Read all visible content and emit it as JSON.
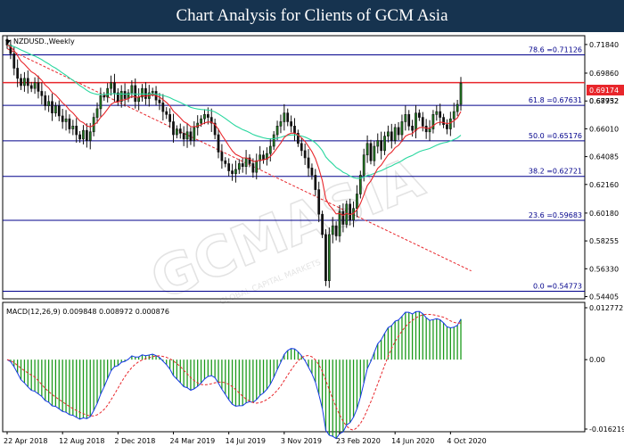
{
  "header": {
    "title": "Chart Analysis for Clients of GCM Asia"
  },
  "colors": {
    "up_candle": "#111111",
    "down_candle": "#111111",
    "candle_body": "#1f7a1f",
    "ema_fast": "#e8262b",
    "ema_slow": "#29d79f",
    "trend_line": "#e8262b",
    "fib": "#00008b",
    "resistance": "#e8262b",
    "macd_hist": "#1b9a1b",
    "macd_line": "#1538e6",
    "signal_line": "#e8262b",
    "price_badge": "#e8262b"
  },
  "chart_data": [
    {
      "type": "candlestick",
      "symbol_label": "NZDUSD.,Weekly",
      "y_ticks": [
        "0.71840",
        "0.69860",
        "0.67932",
        "0.66010",
        "0.64085",
        "0.62160",
        "0.60180",
        "0.58255",
        "0.56330",
        "0.54405"
      ],
      "ylim": [
        0.5425,
        0.7245
      ],
      "x_ticks": [
        "22 Apr 2018",
        "12 Aug 2018",
        "2 Dec 2018",
        "24 Mar 2019",
        "14 Jul 2019",
        "3 Nov 2019",
        "23 Feb 2020",
        "14 Jun 2020",
        "4 Oct 2020"
      ],
      "current_price": "0.69174",
      "current_price_value": 0.69174,
      "upper_price_label": "0.68752",
      "fib_levels": [
        {
          "label": "78.6 =0.71126",
          "value": 0.71126
        },
        {
          "label": "61.8 =0.67631",
          "value": 0.67631
        },
        {
          "label": "50.0 =0.65176",
          "value": 0.65176
        },
        {
          "label": "38.2 =0.62721",
          "value": 0.62721
        },
        {
          "label": "23.6 =0.59683",
          "value": 0.59683
        },
        {
          "label": "0.0 =0.54773",
          "value": 0.54773
        }
      ],
      "resistance": 0.692,
      "trend_line": [
        [
          0,
          0.7155
        ],
        [
          134,
          0.5618
        ]
      ],
      "closes": [
        0.718,
        0.712,
        0.702,
        0.695,
        0.69,
        0.695,
        0.69,
        0.688,
        0.692,
        0.686,
        0.683,
        0.676,
        0.679,
        0.671,
        0.676,
        0.669,
        0.665,
        0.667,
        0.66,
        0.662,
        0.656,
        0.653,
        0.659,
        0.652,
        0.658,
        0.668,
        0.674,
        0.683,
        0.682,
        0.688,
        0.692,
        0.685,
        0.679,
        0.686,
        0.681,
        0.685,
        0.69,
        0.679,
        0.682,
        0.688,
        0.681,
        0.685,
        0.686,
        0.68,
        0.678,
        0.672,
        0.67,
        0.665,
        0.656,
        0.66,
        0.657,
        0.653,
        0.658,
        0.652,
        0.661,
        0.664,
        0.667,
        0.67,
        0.668,
        0.664,
        0.656,
        0.644,
        0.638,
        0.636,
        0.631,
        0.629,
        0.632,
        0.636,
        0.634,
        0.64,
        0.636,
        0.63,
        0.638,
        0.642,
        0.639,
        0.643,
        0.648,
        0.656,
        0.662,
        0.665,
        0.671,
        0.665,
        0.662,
        0.657,
        0.65,
        0.645,
        0.64,
        0.633,
        0.628,
        0.618,
        0.601,
        0.587,
        0.555,
        0.587,
        0.593,
        0.586,
        0.603,
        0.594,
        0.608,
        0.597,
        0.605,
        0.615,
        0.628,
        0.642,
        0.65,
        0.638,
        0.648,
        0.652,
        0.645,
        0.655,
        0.658,
        0.652,
        0.661,
        0.656,
        0.665,
        0.67,
        0.662,
        0.659,
        0.671,
        0.668,
        0.662,
        0.658,
        0.66,
        0.67,
        0.672,
        0.668,
        0.663,
        0.66,
        0.667,
        0.672,
        0.677,
        0.6917
      ]
    },
    {
      "type": "macd",
      "label": "MACD(12,26,9) 0.009848 0.008972 0.000876",
      "y_ticks": [
        "0.012772",
        "0.00",
        "-0.016219"
      ],
      "ylim": [
        -0.0165,
        0.0131
      ],
      "note": "histogram, MACD and signal line derived from the closes"
    }
  ]
}
